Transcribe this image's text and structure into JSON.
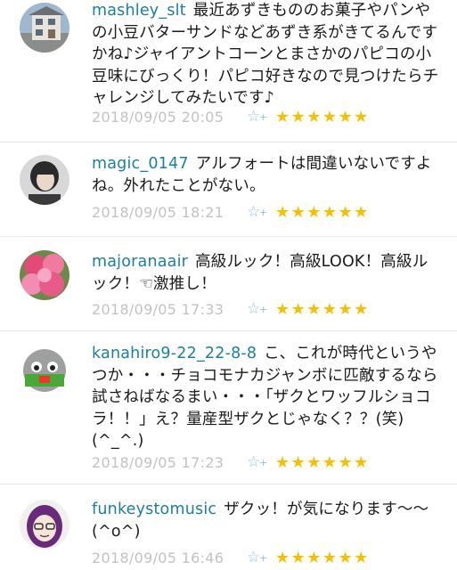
{
  "comments": [
    {
      "username": "mashley_slt",
      "message": "最近あずきもののお菓子やパンやの小豆バターサンドなどあずき系がきてるんですかね♪ジャイアントコーンとまさかのパピコの小豆味にびっくり！パピコ好きなので見つけたらチャレンジしてみたいです♪",
      "timestamp": "2018/09/05 20:05",
      "stars": "★★★★★★"
    },
    {
      "username": "magic_0147",
      "message": "アルフォートは間違いないですよね。外れたことがない。",
      "timestamp": "2018/09/05 18:21",
      "stars": "★★★★★★"
    },
    {
      "username": "majoranaair",
      "message": "高級ルック！高級LOOK！高級ルック！☜激推し！",
      "timestamp": "2018/09/05 17:33",
      "stars": "★★★★★★"
    },
    {
      "username": "kanahiro9-22_22-8-8",
      "message": "こ、これが時代というやつか・・・チョコモナカジャンボに匹敵するなら試さねばなるまい・・・「ザクとワッフルショコラ！！」え？量産型ザクとじゃなく？？(笑)(^_^.)",
      "timestamp": "2018/09/05 17:23",
      "stars": "★★★★★★"
    },
    {
      "username": "funkeystomusic",
      "message": "ザクッ！が気になります〜〜(^o^)",
      "timestamp": "2018/09/05 16:46",
      "stars": "★★★★★★"
    }
  ],
  "icons": {
    "favorite": "star-plus-icon",
    "rating": "star-icon"
  },
  "colors": {
    "username": "#1a7fa0",
    "timestamp": "#c2c2c2",
    "stars": "#f6c000",
    "favorite_icon": "#8fc0e0"
  }
}
